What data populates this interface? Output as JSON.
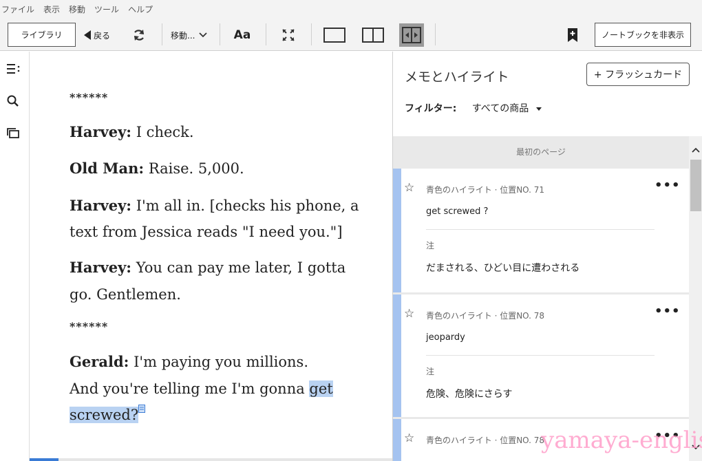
{
  "menu": [
    "ファイル",
    "表示",
    "移動",
    "ツール",
    "ヘルプ"
  ],
  "toolbar": {
    "library": "ライブラリ",
    "back": "戻る",
    "goto": "移動...",
    "font": "Aa",
    "hide_notebook": "ノートブックを非表示"
  },
  "reader": {
    "separator1": "******",
    "line1_speaker": "Harvey:",
    "line1_text": " I check.",
    "line2_speaker": "Old Man:",
    "line2_text": " Raise. 5,000.",
    "line3_speaker": "Harvey:",
    "line3_text_a": " I'm all in. [checks his phone, a",
    "line3_text_b": "text from Jessica reads \"I need you.\"]",
    "line4_speaker": "Harvey:",
    "line4_text_a": " You can pay me later, I gotta",
    "line4_text_b": "go. Gentlemen.",
    "separator2": "******",
    "line5_speaker": "Gerald:",
    "line5_text_a": " I'm paying you millions.",
    "line5_text_b": "And you're telling me I'm gonna ",
    "line5_highlight_a": "get",
    "line5_highlight_b": "screwed?",
    "progress_percent": 8
  },
  "panel": {
    "title": "メモとハイライト",
    "flashcard_button": "+ フラッシュカード",
    "filter_label": "フィルター:",
    "filter_value": "すべての商品",
    "first_page": "最初のページ",
    "cards": [
      {
        "meta": "青色のハイライト · 位置NO. 71",
        "text": "get screwed ?",
        "note_label": "注",
        "note": "だまされる、ひどい目に遭わされる"
      },
      {
        "meta": "青色のハイライト · 位置NO. 78",
        "text": "jeopardy",
        "note_label": "注",
        "note": "危険、危険にさらす"
      },
      {
        "meta": "青色のハイライト · 位置NO. 78"
      }
    ]
  },
  "watermark": "yamaya-english",
  "colors": {
    "highlight": "#b9d2f2",
    "card_bar": "#a5c3f0",
    "watermark": "#ff9ec9"
  }
}
